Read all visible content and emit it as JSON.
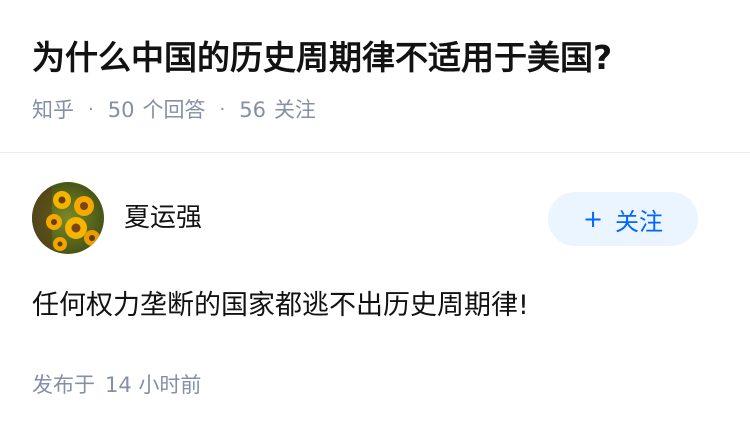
{
  "question": {
    "title": "为什么中国的历史周期律不适用于美国?",
    "source": "知乎",
    "answer_count": "50",
    "answer_label": "个回答",
    "follower_count": "56",
    "follower_label": "关注"
  },
  "answer": {
    "author": {
      "name": "夏运强",
      "avatar_icon": "sunflower-avatar"
    },
    "follow_button": {
      "plus": "+",
      "label": "关注"
    },
    "content": "任何权力垄断的国家都逃不出历史周期律!",
    "published_label": "发布于",
    "published_time": "14 小时前"
  },
  "colors": {
    "title": "#121212",
    "meta": "#8590a6",
    "follow_bg": "#ebf5ff",
    "follow_text": "#0066ff",
    "divider": "#ebebeb"
  }
}
